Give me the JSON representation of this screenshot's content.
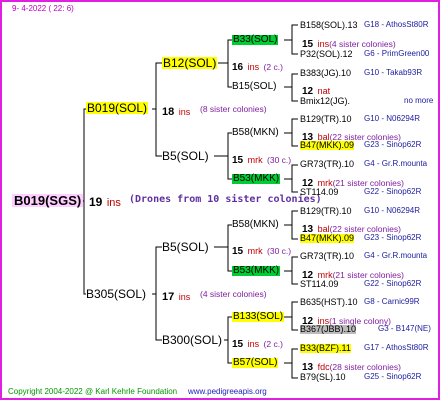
{
  "header": {
    "date": "9-  4-2022 ( 22:  6)"
  },
  "root": {
    "name": "B019(SGS)",
    "ins_num": "19",
    "ins": "ins",
    "comment": "(Drones from 10 sister colonies)"
  },
  "gen1": [
    {
      "name": "B019(SOL)",
      "ins_num": "18",
      "ins": "ins",
      "comment": "(8 sister colonies)"
    },
    {
      "name": "B305(SOL)",
      "ins_num": "17",
      "ins": "ins",
      "comment": "(4 sister colonies)"
    }
  ],
  "gen2": [
    {
      "name": "B12(SOL)",
      "ins_num": "16",
      "ins": "ins",
      "comment": "(2 c.)"
    },
    {
      "name": "B5(SOL)",
      "ins_num": "15",
      "ins": "mrk",
      "comment": "(30 c.)"
    },
    {
      "name": "B5(SOL)",
      "ins_num": "15",
      "ins": "mrk",
      "comment": "(30 c.)"
    },
    {
      "name": "B300(SOL)",
      "ins_num": "15",
      "ins": "ins",
      "comment": "(2 c.)"
    }
  ],
  "gen3": [
    {
      "name": "B33(SOL)",
      "ins_num": "15",
      "ins": "ins",
      "comment": "(4 sister colonies)"
    },
    {
      "name": "B15(SOL)",
      "ins_num": "12",
      "ins": "nat",
      "comment": ""
    },
    {
      "name": "B58(MKN)",
      "ins_num": "13",
      "ins": "bal",
      "comment": "(22 sister colonies)"
    },
    {
      "name": "B53(MKK)",
      "ins_num": "12",
      "ins": "mrk",
      "comment": "(21 sister colonies)"
    },
    {
      "name": "B58(MKN)",
      "ins_num": "13",
      "ins": "bal",
      "comment": "(22 sister colonies)"
    },
    {
      "name": "B53(MKK)",
      "ins_num": "12",
      "ins": "mrk",
      "comment": "(21 sister colonies)"
    },
    {
      "name": "B133(SOL)",
      "ins_num": "12",
      "ins": "ins",
      "comment": "(1 single colony)"
    },
    {
      "name": "B57(SOL)",
      "ins_num": "13",
      "ins": "fdc",
      "comment": "(28 sister colonies)"
    }
  ],
  "gen4": [
    {
      "name": "B158(SOL).13",
      "ref": "G18 - AthosSt80R"
    },
    {
      "name": "P32(SOL).12",
      "ref": "G6 - PrimGreen00"
    },
    {
      "name": "B383(JG).10",
      "ref": "G10 - Takab93R"
    },
    {
      "name": "Bmix12(JG).",
      "ref": "no more"
    },
    {
      "name": "B129(TR).10",
      "ref": "G10 - N06294R"
    },
    {
      "name": "B47(MKK).09",
      "ref": "G23 - Sinop62R"
    },
    {
      "name": "GR73(TR).10",
      "ref": "G4 - Gr.R.mounta"
    },
    {
      "name": "ST114.09",
      "ref": "G22 - Sinop62R"
    },
    {
      "name": "B129(TR).10",
      "ref": "G10 - N06294R"
    },
    {
      "name": "B47(MKK).09",
      "ref": "G23 - Sinop62R"
    },
    {
      "name": "GR73(TR).10",
      "ref": "G4 - Gr.R.mounta"
    },
    {
      "name": "ST114.09",
      "ref": "G22 - Sinop62R"
    },
    {
      "name": "B635(HST).10",
      "ref": "G8 - Carnic99R"
    },
    {
      "name": "B367(JBB).10",
      "ref": "G3 - B147(NE)"
    },
    {
      "name": "B33(BZF).11",
      "ref": "G17 - AthosSt80R"
    },
    {
      "name": "B79(SL).10",
      "ref": "G25 - Sinop62R"
    }
  ],
  "footer": {
    "copyright": "Copyright 2004-2022 @ Karl Kehrle Foundation",
    "site": "www.pedigreeapis.org"
  },
  "colors": {
    "frame": "#e020e0",
    "highlight_yellow": "#ffff00",
    "highlight_green": "#00cc33",
    "highlight_gray": "#bbbbbb",
    "ins_red": "#c00000",
    "comment_purple": "#8020a0",
    "footer_green": "#009900",
    "footer_blue": "#2020c0"
  }
}
